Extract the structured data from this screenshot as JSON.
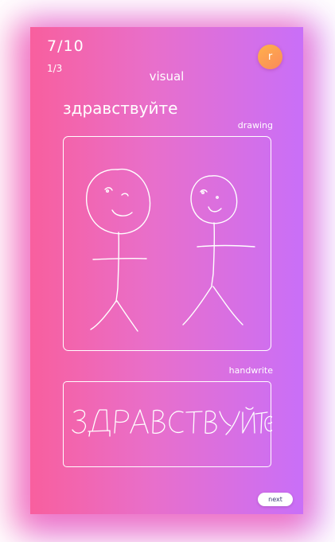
{
  "header": {
    "progress": "7/10",
    "subprogress": "1/3",
    "mode": "visual",
    "avatar_initial": "r"
  },
  "card": {
    "word": "здравствуйте",
    "drawing_label": "drawing",
    "handwrite_label": "handwrite",
    "drawing_image": "two-stick-figures-sketch",
    "handwrite_image": "handwritten-word-sketch"
  },
  "footer": {
    "next_label": "next"
  },
  "colors": {
    "gradient_left": "#f85f9e",
    "gradient_right": "#c96ff8",
    "avatar": "#fca052",
    "stroke": "#ffffff"
  }
}
